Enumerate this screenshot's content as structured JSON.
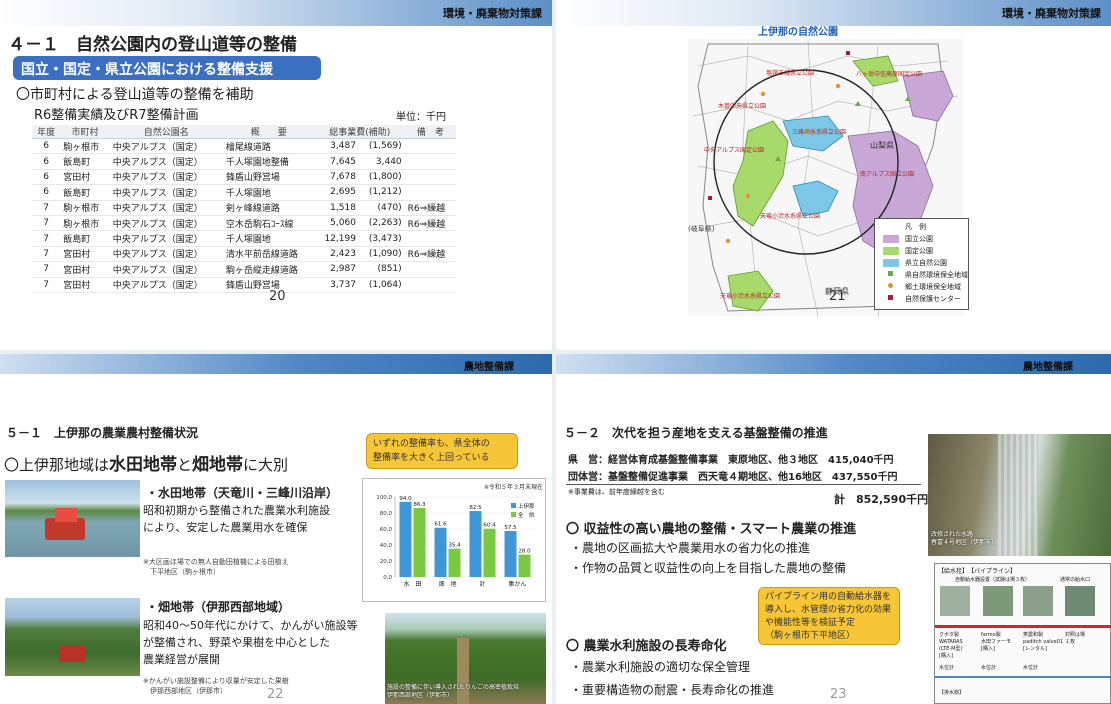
{
  "slide20": {
    "dept": "環境・廃棄物対策課",
    "title": "４－１　自然公園内の登山道等の整備",
    "banner": "国立・国定・県立公園における整備支援",
    "lead": "〇市町村による登山道等の整備を補助",
    "subhead": "R6整備実績及びR7整備計画",
    "unit": "単位：千円",
    "headers": [
      "年度",
      "市町村",
      "自然公園名",
      "概　　要",
      "総事業費(補助)",
      "備　考"
    ],
    "rows": [
      [
        "6",
        "駒ヶ根市",
        "中央アルプス（国定）",
        "檜尾線道路",
        "3,487",
        "(1,569)",
        ""
      ],
      [
        "6",
        "飯島町",
        "中央アルプス（国定）",
        "千人塚園地整備",
        "7,645",
        "3,440",
        ""
      ],
      [
        "6",
        "宮田村",
        "中央アルプス（国定）",
        "鋒盾山野営場",
        "7,678",
        "(1,800)",
        ""
      ],
      [
        "6",
        "飯島町",
        "中央アルプス（国定）",
        "千人塚園地",
        "2,695",
        "(1,212)",
        ""
      ],
      [
        "7",
        "駒ヶ根市",
        "中央アルプス（国定）",
        "剣ヶ峰線道路",
        "1,518",
        "(470)",
        "R6⇒繰越"
      ],
      [
        "7",
        "駒ヶ根市",
        "中央アルプス（国定）",
        "空木岳駒石ｺｰｽ線",
        "5,060",
        "(2,263)",
        "R6⇒繰越"
      ],
      [
        "7",
        "飯島町",
        "中央アルプス（国定）",
        "千人塚園地",
        "12,199",
        "(3,473)",
        ""
      ],
      [
        "7",
        "宮田村",
        "中央アルプス（国定）",
        "清水平前岳線道路",
        "2,423",
        "(1,090)",
        "R6⇒繰越"
      ],
      [
        "7",
        "宮田村",
        "中央アルプス（国定）",
        "駒ヶ岳縦走線道路",
        "2,987",
        "(851)",
        ""
      ],
      [
        "7",
        "宮田村",
        "中央アルプス（国定）",
        "鋒盾山野営場",
        "3,737",
        "(1,064)",
        ""
      ]
    ],
    "page": "20"
  },
  "slide21": {
    "dept": "環境・廃棄物対策課",
    "map_title": "上伊那の自然公園",
    "labels": {
      "yamanashi": "山梨県",
      "shizuoka": "静岡県",
      "gifu": "(岐阜県)",
      "chuo": "中央アルプス国定公園",
      "minami": "南アルプス国立公園",
      "sanpo": "三峰川水系県立公園",
      "tenryu": "天竜小渋水系県立公園",
      "tenryu2": "天竜小渋水系県立公園",
      "yatsu": "八ヶ岳中信高原国定公園",
      "enrei": "塩嶺王城県立公園",
      "kiso": "木曽中央県立公園"
    },
    "legend_title": "凡　例",
    "legend": [
      {
        "label": "国立公園",
        "color": "#c9a7d6"
      },
      {
        "label": "国定公園",
        "color": "#a8d96b"
      },
      {
        "label": "県立自然公園",
        "color": "#7cc7e6"
      },
      {
        "label": "県自然環境保全地域",
        "color": "#6aa84f"
      },
      {
        "label": "郷土環境保全地域",
        "color": "#e69138"
      },
      {
        "label": "自然保護センター",
        "color": "#a61c3c"
      }
    ],
    "page": "21"
  },
  "slide22": {
    "dept": "農地整備課",
    "title": "５－１　上伊那の農業農村整備状況",
    "lead_a": "〇上伊那地域は",
    "lead_b": "水田地帯",
    "lead_c": "と",
    "lead_d": "畑地帯",
    "lead_e": "に大別",
    "callout": "いずれの整備率も、県全体の\n整備率を大きく上回っている",
    "paddy_head": "・水田地帯（天竜川・三峰川沿岸）",
    "paddy_body": "昭和初期から整備された農業水利施設\nにより、安定した農業用水を確保",
    "paddy_note": "※大区画ほ場での無人自動田植機による田植え\n　下平地区（駒ヶ根市）",
    "field_head": "・畑地帯（伊那西部地域）",
    "field_body": "昭和40～50年代にかけて、かんがい施設等\nが整備され、野菜や果樹を中心とした\n農業経営が展開",
    "field_note": "※かんがい施設整備により収量が安定した果樹\n　伊那西部地区（伊那市）",
    "orchard_caption": "施設の整備に伴い導入されたりんごの高密植栽培\n伊那西部地区（伊那市）",
    "page": "22"
  },
  "chart_data": {
    "type": "bar",
    "title": "",
    "note": "※令和５年３月末現在",
    "categories": [
      "水　田",
      "畑　地",
      "計",
      "集かん"
    ],
    "series": [
      {
        "name": "上伊那",
        "values": [
          94.0,
          61.6,
          82.5,
          57.5
        ],
        "color": "#3f97d7"
      },
      {
        "name": "全　県",
        "values": [
          86.3,
          35.4,
          60.4,
          28.0
        ],
        "color": "#7ac943"
      }
    ],
    "ylim": [
      0,
      100
    ],
    "yticks": [
      "0.0",
      "20.0",
      "40.0",
      "60.0",
      "80.0",
      "100.0"
    ],
    "value_labels": [
      [
        "94.0",
        "61.6",
        "82.5",
        "57.5"
      ],
      [
        "86.3",
        "35.4",
        "60.4",
        "28.0"
      ]
    ]
  },
  "slide23": {
    "dept": "農地整備課",
    "title": "５－２　次代を担う産地を支える基盤整備の推進",
    "line1a": "県　営：経営体育成基盤整備事業　東原地区、他３地区",
    "line1b": "415,040千円",
    "line2a": "団体営：基盤整備促進事業　西天竜４期地区、他16地区",
    "line2b": "437,550千円",
    "footnote": "※事業費は、前年度繰越を含む",
    "total_label": "計",
    "total": "852,590千円",
    "sec1": "〇 収益性の高い農地の整備・スマート農業の推進",
    "b1": "・農地の区画拡大や農業用水の省力化の推進",
    "b2": "・作物の品質と収益性の向上を目指した農地の整備",
    "callout": "パイプライン用の自動給水器を\n導入し、水管理の省力化の効果\nや機能性等を検証予定\n（駒ヶ根市下平地区）",
    "sec2": "〇 農業水利施設の長寿命化",
    "b3": "・農業水利施設の適切な保全管理",
    "b4": "・重要構造物の耐震・長寿命化の推進",
    "photo_caption": "改修された水路\n春富４号地区（伊那市）",
    "diagram_title": "【給水栓】　【パイプライン】",
    "diagram_sub": "自動給水器設置（試験は場３枚）",
    "diagram_sub2": "通常の給水口",
    "devices": [
      "クボタ製\nWATARAS\n(LTE-M型)\n[購入]",
      "farmo製\n水田ファーモ\n[購入]",
      "笑農和製\npaditch valve01\n[レンタル]",
      "対照は場\n１枚"
    ],
    "sensor": "水位計",
    "drain": "【排水側】",
    "page": "23"
  }
}
